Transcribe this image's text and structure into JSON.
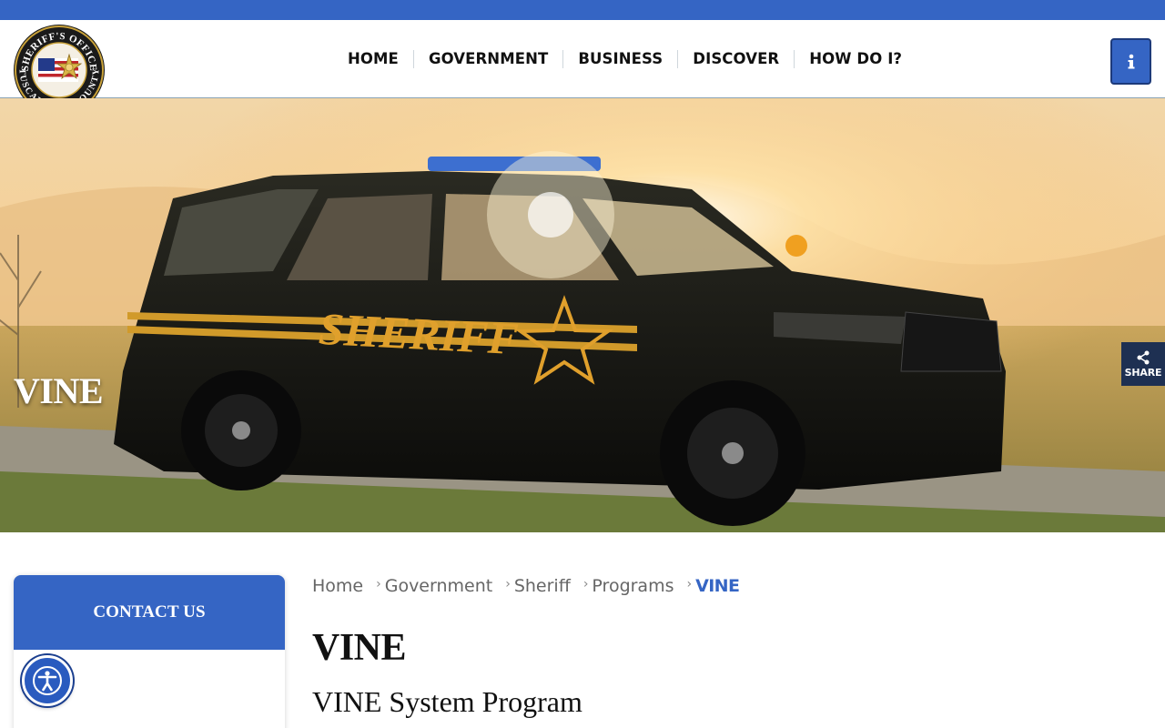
{
  "header": {
    "logo_text": "SHERIFF'S OFFICE TUSCARAWAS COUNTY",
    "nav": [
      {
        "label": "HOME"
      },
      {
        "label": "GOVERNMENT"
      },
      {
        "label": "BUSINESS"
      },
      {
        "label": "DISCOVER"
      },
      {
        "label": "HOW DO I?"
      }
    ],
    "info_icon": "info-icon"
  },
  "hero": {
    "title": "VINE",
    "vehicle_text": "SHERIFF",
    "share_label": "SHARE",
    "share_icon": "share-icon"
  },
  "sidebar": {
    "title": "CONTACT US"
  },
  "accessibility": {
    "icon": "accessibility-icon"
  },
  "breadcrumb": {
    "items": [
      "Home",
      "Government",
      "Sheriff",
      "Programs"
    ],
    "current": "VINE",
    "separator": "›"
  },
  "content": {
    "title": "VINE",
    "subtitle": "VINE System Program"
  },
  "colors": {
    "brand_blue": "#3565c4",
    "share_bg": "#1e3052",
    "text": "#111111",
    "breadcrumb_text": "#666666"
  }
}
